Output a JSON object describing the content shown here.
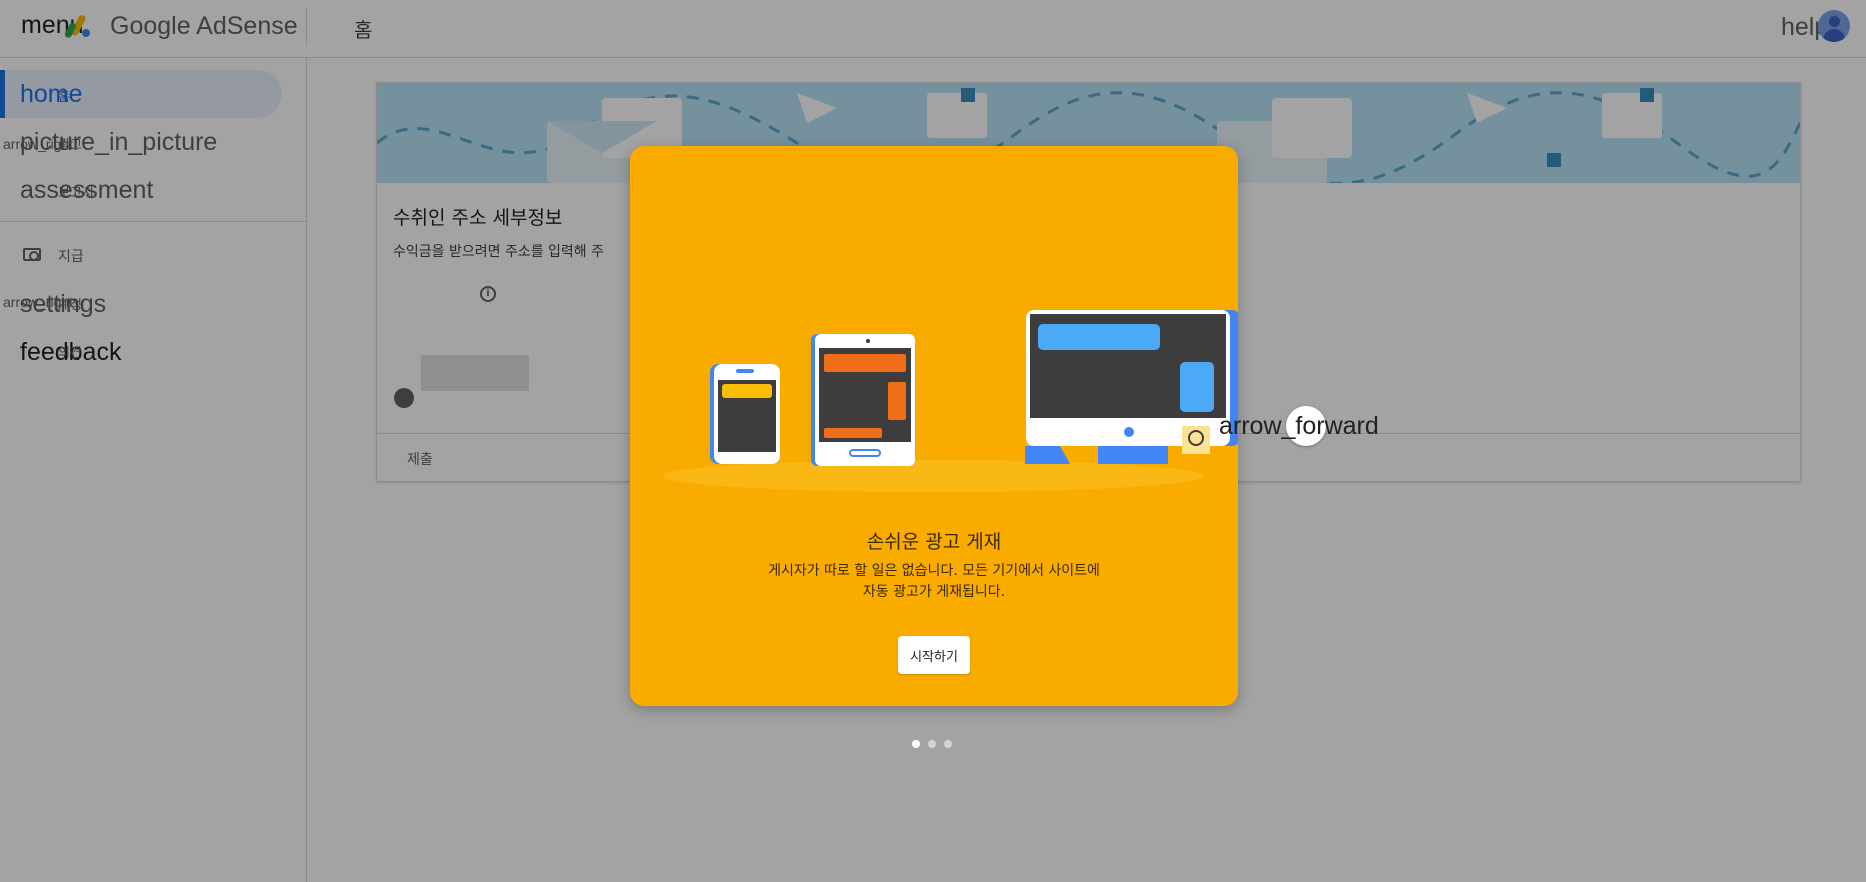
{
  "topbar": {
    "menu_icon_text": "menu",
    "brand": "Google AdSense",
    "breadcrumb": "홈",
    "help_icon_text": "help"
  },
  "sidebar": {
    "items": [
      {
        "icon_text": "home",
        "label": "홈",
        "active": true
      },
      {
        "icon_text": "picture_in_picture",
        "label": "광고",
        "arrow_text": "arrow_right"
      },
      {
        "icon_text": "assessment",
        "label": "보고서"
      },
      {
        "icon_text": "",
        "label": "지급"
      },
      {
        "icon_text": "settings",
        "label": "계정",
        "arrow_text": "arrow_right"
      },
      {
        "icon_text": "feedback",
        "label": "의견"
      }
    ]
  },
  "card": {
    "title": "수취인 주소 세부정보",
    "subtitle": "수익금을 받으려면 주소를 입력해 주",
    "info_icon": "info-icon",
    "person_icon": "account-circle-icon",
    "submit_label": "제출"
  },
  "promo": {
    "title": "손쉬운 광고 게재",
    "body_line1": "게시자가 따로 할 일은 없습니다. 모든 기기에서 사이트에",
    "body_line2": "자동 광고가 게재됩니다.",
    "cta_label": "시작하기",
    "next_icon_text": "arrow_forward",
    "pagination": {
      "current": 1,
      "total": 3
    },
    "background_color": "#f9ab00"
  },
  "colors": {
    "accent": "#1a73e8",
    "banner": "#b7e3f7",
    "scrim": "rgba(0,0,0,0.36)"
  }
}
